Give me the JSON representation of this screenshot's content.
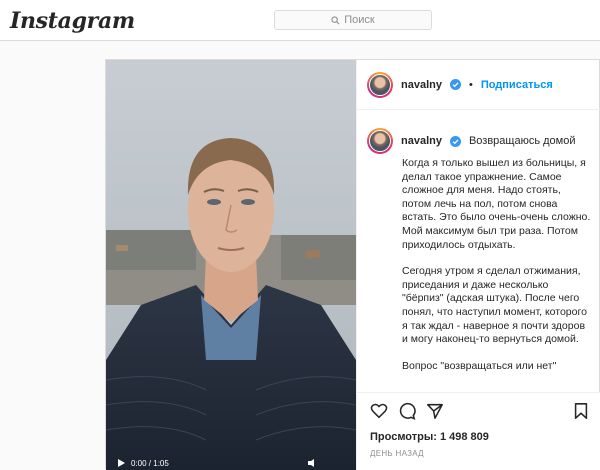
{
  "app": {
    "logo": "Instagram"
  },
  "search": {
    "placeholder": "Поиск"
  },
  "post": {
    "username": "navalny",
    "follow_label": "Подписаться",
    "separator": "•",
    "caption_title": "Возвращаюсь домой",
    "caption_paragraphs": [
      "Когда я только вышел из больницы, я делал такое упражнение. Самое сложное для меня. Надо стоять, потом лечь на пол, потом снова встать. Это было очень-очень сложно. Мой максимум был три раза. Потом приходилось отдыхать.",
      "Сегодня утром я сделал отжимания, приседания и даже несколько \"бёрпиз\" (адская штука). После чего понял, что наступил момент, которого я так ждал - наверное я почти здоров и могу наконец-то вернуться домой.",
      "Вопрос \"возвращаться или нет\""
    ],
    "views": "Просмотры: 1 498 809",
    "time": "ДЕНЬ НАЗАД"
  },
  "video": {
    "time": "0:00 / 1:05"
  },
  "icons": [
    "instagram-logo",
    "search-icon",
    "verified-badge-icon",
    "heart-icon",
    "comment-icon",
    "share-icon",
    "bookmark-icon",
    "play-icon",
    "volume-icon"
  ],
  "colors": {
    "accent": "#0095f6",
    "text": "#262626",
    "muted": "#8e8e8e",
    "border": "#dbdbdb"
  }
}
